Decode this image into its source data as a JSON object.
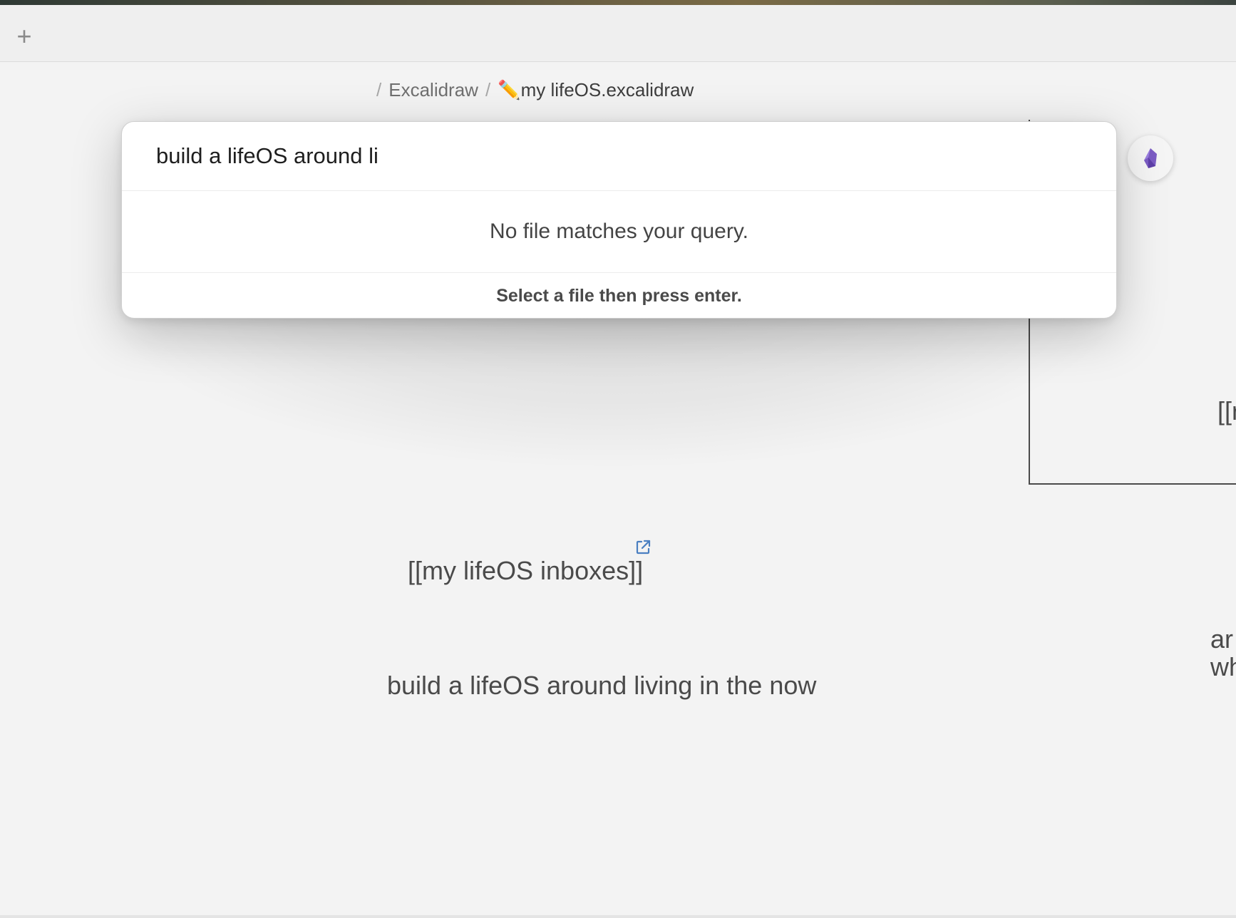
{
  "tab_bar": {
    "new_tab_icon": "+"
  },
  "breadcrumb": {
    "folder": "Excalidraw",
    "separator": "/",
    "file_icon": "✏️",
    "file": "my lifeOS.excalidraw"
  },
  "quick_switcher": {
    "query": "build a lifeOS around li",
    "empty_message": "No file matches your query.",
    "footer_instruction": "Select a file then press enter."
  },
  "canvas": {
    "link_text": "[[my lifeOS inboxes]]",
    "main_text": "build a lifeOS around living in the now",
    "partial_link_right": "[[r",
    "partial_text_right_line1": "ar",
    "partial_text_right_line2": "wh"
  },
  "colors": {
    "accent_purple": "#7b5cc4",
    "link_icon_blue": "#4a7fc1"
  }
}
